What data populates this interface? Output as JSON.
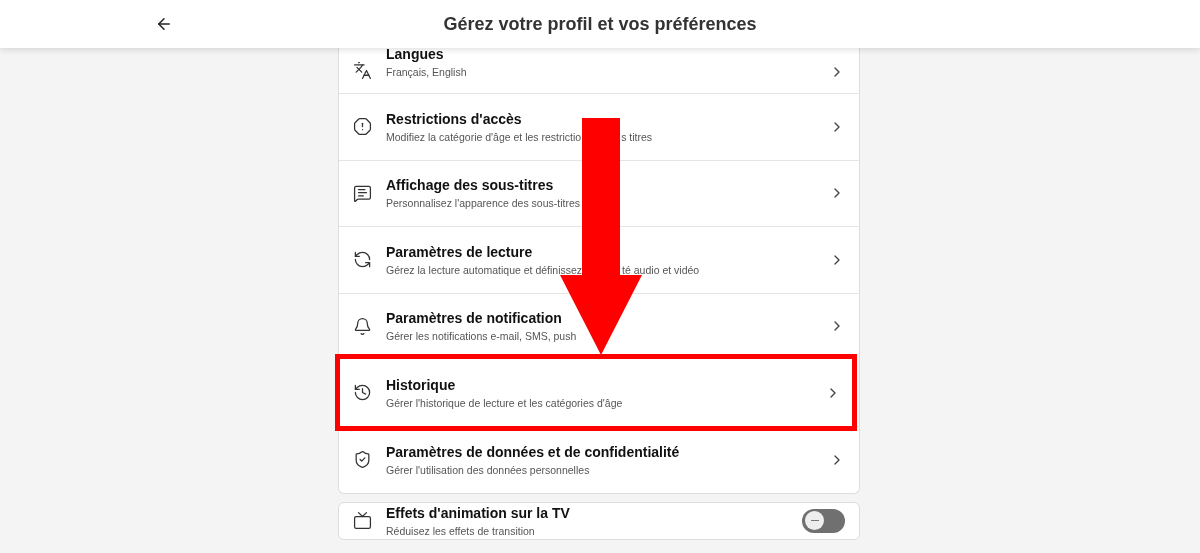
{
  "header": {
    "title": "Gérez votre profil et vos préférences"
  },
  "cards": [
    {
      "rows": [
        {
          "kind": "link",
          "title": "Langues",
          "description": [
            "Français, English"
          ],
          "highlighted": false
        },
        {
          "kind": "link",
          "title": "Restrictions d'accès",
          "description": [
            "Modifiez la catégorie d'âge et les restrictio",
            "s titres"
          ],
          "highlighted": false
        },
        {
          "kind": "link",
          "title": "Affichage des sous-titres",
          "description": [
            "Personnalisez l'apparence des sous-titres"
          ],
          "highlighted": false
        },
        {
          "kind": "link",
          "title": "Paramètres de lecture",
          "description": [
            "Gérez la lecture automatique et définissez",
            "té audio et vidéo"
          ],
          "highlighted": false
        },
        {
          "kind": "link",
          "title": "Paramètres de notification",
          "description": [
            "Gérer les notifications e-mail, SMS, push"
          ],
          "highlighted": false
        },
        {
          "kind": "link",
          "title": "Historique",
          "description": [
            "Gérer l'historique de lecture et les catégories d'âge"
          ],
          "highlighted": true
        },
        {
          "kind": "link",
          "title": "Paramètres de données et de confidentialité",
          "description": [
            "Gérer l'utilisation des données personnelles"
          ],
          "highlighted": false
        }
      ]
    },
    {
      "rows": [
        {
          "kind": "toggle",
          "title": "Effets d'animation sur la TV",
          "description": [
            "Réduisez les effets de transition"
          ],
          "on": false,
          "highlighted": false
        }
      ]
    }
  ]
}
